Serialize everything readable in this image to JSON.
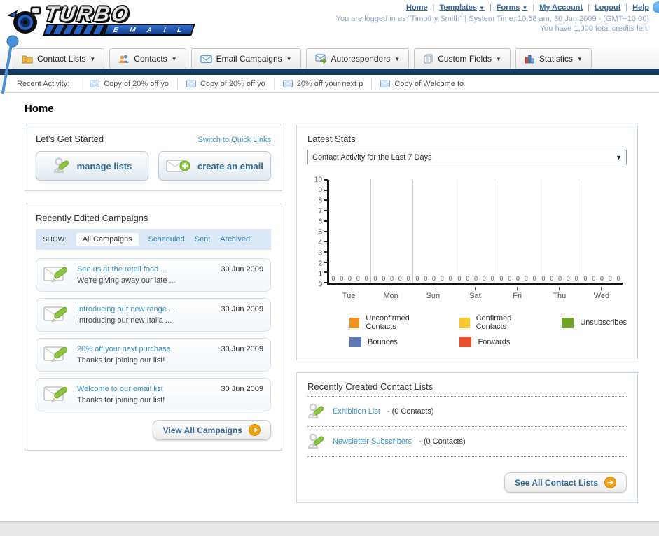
{
  "colors": {
    "navy_bar": "#17395e",
    "header_link": "#336699",
    "muted_blue_text": "#8aa4c4",
    "accent_orange": "#f29c11",
    "filter_bar_bg": "#dbe9f6"
  },
  "header": {
    "logo_line1": "TURBO",
    "logo_line2": "E M A I L",
    "nav_links": [
      {
        "label": "Home",
        "dropdown": false
      },
      {
        "label": "Templates",
        "dropdown": true
      },
      {
        "label": "Forms",
        "dropdown": true
      },
      {
        "label": "My Account",
        "dropdown": false
      },
      {
        "label": "Logout",
        "dropdown": false
      },
      {
        "label": "Help",
        "dropdown": false
      }
    ],
    "login_info": "You are logged in as \"Timothy Smith\" | System Time: 10:58 am, 30 Jun 2009 - (GMT+10:00)",
    "credits_info": "You have 1,000 total credits left."
  },
  "tabs": [
    {
      "label": "Contact Lists",
      "icon": "contact-lists-icon"
    },
    {
      "label": "Contacts",
      "icon": "contacts-icon"
    },
    {
      "label": "Email Campaigns",
      "icon": "email-campaigns-icon"
    },
    {
      "label": "Autoresponders",
      "icon": "autoresponders-icon"
    },
    {
      "label": "Custom Fields",
      "icon": "custom-fields-icon"
    },
    {
      "label": "Statistics",
      "icon": "statistics-icon"
    }
  ],
  "recent_activity": {
    "label": "Recent Activity:",
    "items": [
      "Copy of 20% off yo",
      "Copy of 20% off yo",
      "20% off your next p",
      "Copy of Welcome to"
    ]
  },
  "page_title": "Home",
  "get_started": {
    "title": "Let's Get Started",
    "switch_link": "Switch to Quick Links",
    "buttons": [
      {
        "label": "manage lists",
        "icon": "pencil-person-icon"
      },
      {
        "label": "create an email",
        "icon": "email-plus-icon"
      }
    ]
  },
  "campaigns": {
    "title": "Recently Edited Campaigns",
    "show_label": "SHOW:",
    "filters": [
      "All Campaigns",
      "Scheduled",
      "Sent",
      "Archived"
    ],
    "active_filter": "All Campaigns",
    "items": [
      {
        "title": "See us at the retail food ...",
        "subtitle": "We're giving away our late ...",
        "date": "30 Jun 2009"
      },
      {
        "title": "Introducing our new range ...",
        "subtitle": "Introducing our new Italia ...",
        "date": "30 Jun 2009"
      },
      {
        "title": "20% off your next purchase",
        "subtitle": "Thanks for joining our list!",
        "date": "30 Jun 2009"
      },
      {
        "title": "Welcome to our email list",
        "subtitle": "Thanks for joining our list!",
        "date": "30 Jun 2009"
      }
    ],
    "view_all_label": "View All Campaigns"
  },
  "latest_stats": {
    "title": "Latest Stats",
    "dropdown_value": "Contact Activity for the Last 7 Days"
  },
  "chart_data": {
    "type": "bar",
    "title": "Contact Activity for the Last 7 Days",
    "categories": [
      "Tue",
      "Mon",
      "Sun",
      "Sat",
      "Fri",
      "Thu",
      "Wed"
    ],
    "series": [
      {
        "name": "Unconfirmed Contacts",
        "color": "#f5921e",
        "values": [
          0,
          0,
          0,
          0,
          0,
          0,
          0
        ]
      },
      {
        "name": "Confirmed Contacts",
        "color": "#fdc72f",
        "values": [
          0,
          0,
          0,
          0,
          0,
          0,
          0
        ]
      },
      {
        "name": "Unsubscribes",
        "color": "#6da224",
        "values": [
          0,
          0,
          0,
          0,
          0,
          0,
          0
        ]
      },
      {
        "name": "Bounces",
        "color": "#5c79b5",
        "values": [
          0,
          0,
          0,
          0,
          0,
          0,
          0
        ]
      },
      {
        "name": "Forwards",
        "color": "#e8512e",
        "values": [
          0,
          0,
          0,
          0,
          0,
          0,
          0
        ]
      }
    ],
    "xlabel": "",
    "ylabel": "",
    "ylim": [
      0,
      10
    ],
    "ytick_step": 1,
    "grid": true,
    "legend_position": "bottom"
  },
  "contact_lists": {
    "title": "Recently Created Contact Lists",
    "items": [
      {
        "name": "Exhibition List",
        "detail": "- (0 Contacts)"
      },
      {
        "name": "Newsletter Subscribers",
        "detail": "- (0 Contacts)"
      }
    ],
    "see_all_label": "See All Contact Lists"
  }
}
